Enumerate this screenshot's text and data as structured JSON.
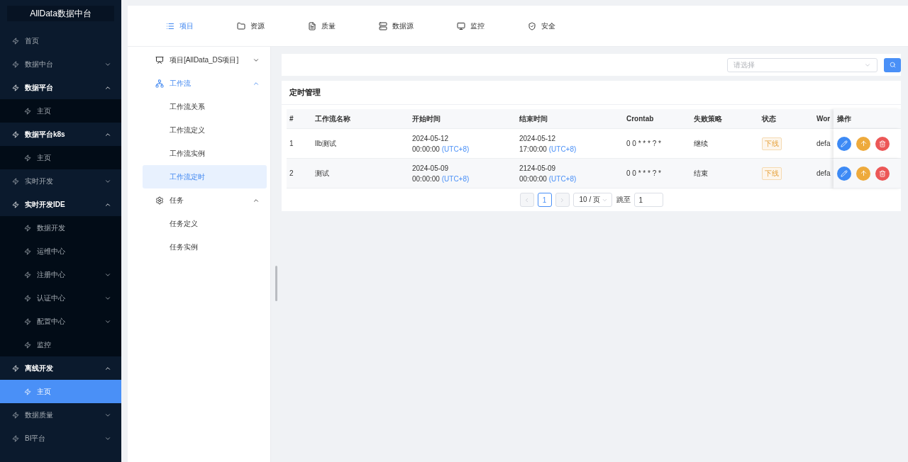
{
  "sidebar": {
    "title": "AllData数据中台",
    "items": [
      {
        "label": "首页",
        "selected": false
      },
      {
        "label": "数据中台",
        "selected": false,
        "expanded": false
      },
      {
        "label": "数据平台",
        "selected": false,
        "expanded": true,
        "children": [
          {
            "label": "主页",
            "selected": false
          }
        ]
      },
      {
        "label": "数据平台k8s",
        "selected": false,
        "expanded": true,
        "children": [
          {
            "label": "主页",
            "selected": false
          }
        ]
      },
      {
        "label": "实时开发",
        "selected": false,
        "expanded": false
      },
      {
        "label": "实时开发IDE",
        "selected": false,
        "expanded": true,
        "children": [
          {
            "label": "数据开发",
            "selected": false
          },
          {
            "label": "运维中心",
            "selected": false
          },
          {
            "label": "注册中心",
            "selected": false,
            "expanded": false
          },
          {
            "label": "认证中心",
            "selected": false,
            "expanded": false
          },
          {
            "label": "配置中心",
            "selected": false,
            "expanded": false
          },
          {
            "label": "监控",
            "selected": false
          }
        ]
      },
      {
        "label": "离线开发",
        "selected": false,
        "expanded": true,
        "children": [
          {
            "label": "主页",
            "selected": true
          }
        ]
      },
      {
        "label": "数据质量",
        "selected": false,
        "expanded": false
      },
      {
        "label": "BI平台",
        "selected": false,
        "expanded": false
      }
    ]
  },
  "top_tabs": [
    {
      "label": "项目",
      "selected": true
    },
    {
      "label": "资源",
      "selected": false
    },
    {
      "label": "质量",
      "selected": false
    },
    {
      "label": "数据源",
      "selected": false
    },
    {
      "label": "监控",
      "selected": false
    },
    {
      "label": "安全",
      "selected": false
    }
  ],
  "nav_menu": [
    {
      "label": "项目[AllData_DS项目]",
      "expanded": false
    },
    {
      "label": "工作流",
      "expanded": true,
      "children": [
        {
          "label": "工作流关系",
          "selected": false
        },
        {
          "label": "工作流定义",
          "selected": false
        },
        {
          "label": "工作流实例",
          "selected": false
        },
        {
          "label": "工作流定时",
          "selected": true
        }
      ]
    },
    {
      "label": "任务",
      "expanded": true,
      "children": [
        {
          "label": "任务定义",
          "selected": false
        },
        {
          "label": "任务实例",
          "selected": false
        }
      ]
    }
  ],
  "filter": {
    "placeholder": "请选择"
  },
  "card": {
    "title": "定时管理"
  },
  "table": {
    "columns": [
      "#",
      "工作流名称",
      "开始时间",
      "结束时间",
      "Crontab",
      "失败策略",
      "状态",
      "Wor",
      "操作"
    ],
    "rows": [
      {
        "index": "1",
        "name": "llb测试",
        "start": {
          "date": "2024-05-12",
          "time": "00:00:00",
          "zone": "(UTC+8)"
        },
        "end": {
          "date": "2024-05-12",
          "time": "17:00:00",
          "zone": "(UTC+8)"
        },
        "crontab": "0 0 * * * ? *",
        "failure": "继续",
        "status": "下线",
        "column_8": "defa"
      },
      {
        "index": "2",
        "name": "测试",
        "start": {
          "date": "2024-05-09",
          "time": "00:00:00",
          "zone": "(UTC+8)"
        },
        "end": {
          "date": "2124-05-09",
          "time": "00:00:00",
          "zone": "(UTC+8)"
        },
        "crontab": "0 0 * * * ? *",
        "failure": "结束",
        "status": "下线",
        "column_8": "defa"
      }
    ]
  },
  "pagination": {
    "pages": [
      {
        "label": "1",
        "selected": true
      }
    ],
    "page_size": "10 / 页",
    "jump_label": "跳至",
    "jump_value": "1"
  }
}
